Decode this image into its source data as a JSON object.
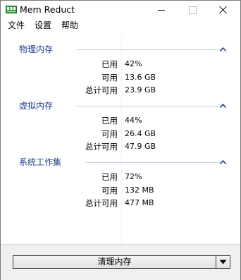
{
  "window": {
    "title": "Mem Reduct"
  },
  "menu": {
    "file": "文件",
    "settings": "设置",
    "help": "帮助"
  },
  "groups": [
    {
      "title": "物理内存",
      "rows": [
        {
          "label": "已用",
          "value": "42%"
        },
        {
          "label": "可用",
          "value": "13.6 GB"
        },
        {
          "label": "总计可用",
          "value": "23.9 GB"
        }
      ]
    },
    {
      "title": "虚拟内存",
      "rows": [
        {
          "label": "已用",
          "value": "44%"
        },
        {
          "label": "可用",
          "value": "26.4 GB"
        },
        {
          "label": "总计可用",
          "value": "47.9 GB"
        }
      ]
    },
    {
      "title": "系统工作集",
      "rows": [
        {
          "label": "已用",
          "value": "72%"
        },
        {
          "label": "可用",
          "value": "132 MB"
        },
        {
          "label": "总计可用",
          "value": "477 MB"
        }
      ]
    }
  ],
  "footer": {
    "clean_label": "清理内存"
  },
  "icons": {
    "app": "memory-chip-icon",
    "minimize": "minimize-icon",
    "maximize": "maximize-icon",
    "close": "close-icon",
    "collapse": "chevron-up-icon",
    "dropdown": "triangle-down-icon"
  },
  "colors": {
    "group_title": "#1f3f8f",
    "app_icon_green": "#2e9e3e"
  }
}
